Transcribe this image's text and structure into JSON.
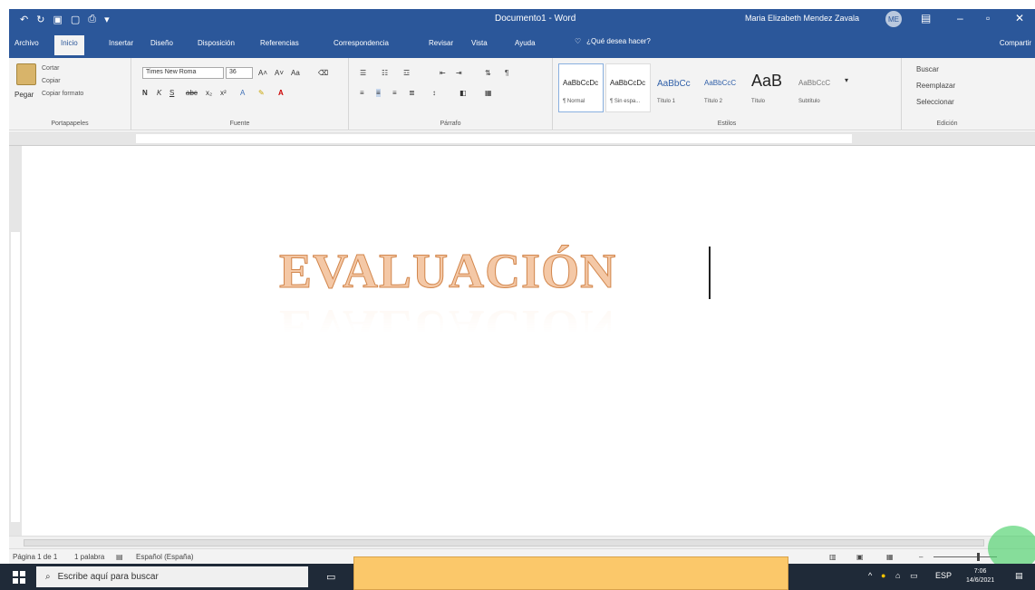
{
  "window": {
    "doc_title": "Documento1 - Word",
    "user_name": "Maria Elizabeth Mendez Zavala",
    "avatar_initials": "ME"
  },
  "quick_access": {
    "undo_icon": "undo-icon",
    "redo_icon": "redo-icon",
    "save_icon": "save-icon"
  },
  "tabs": [
    "Archivo",
    "Inicio",
    "Insertar",
    "Diseño",
    "Disposición",
    "Referencias",
    "Correspondencia",
    "Revisar",
    "Vista",
    "Ayuda"
  ],
  "tell_me": "¿Qué desea hacer?",
  "share": "Compartir",
  "ribbon": {
    "clipboard": {
      "paste": "Pegar",
      "cut": "Cortar",
      "copy": "Copiar",
      "format_painter": "Copiar formato",
      "label": "Portapapeles"
    },
    "font": {
      "family": "Times New Roma",
      "size": "36",
      "label": "Fuente"
    },
    "paragraph": {
      "label": "Párrafo"
    },
    "styles": {
      "label": "Estilos",
      "items": [
        {
          "sample": "AaBbCcDc",
          "name": "¶ Normal"
        },
        {
          "sample": "AaBbCcDc",
          "name": "¶ Sin espa..."
        },
        {
          "sample": "AaBbCc",
          "name": "Título 1"
        },
        {
          "sample": "AaBbCcC",
          "name": "Título 2"
        },
        {
          "sample": "AaB",
          "name": "Título"
        },
        {
          "sample": "AaBbCcC",
          "name": "Subtítulo"
        }
      ]
    },
    "editing": {
      "find": "Buscar",
      "replace": "Reemplazar",
      "select": "Seleccionar",
      "label": "Edición"
    }
  },
  "document": {
    "wordart_text": "EVALUACIÓN"
  },
  "status": {
    "page": "Página 1 de 1",
    "words": "1 palabra",
    "language": "Español (España)"
  },
  "taskbar": {
    "search_placeholder": "Escribe aquí para buscar",
    "lang": "ESP",
    "time": "7:06",
    "date": "14/6/2021"
  },
  "colors": {
    "word_blue": "#2b579a",
    "wordart_fill": "#f4c8a6",
    "wordart_outline": "#d2864c",
    "overlay": "#fbc86a"
  }
}
